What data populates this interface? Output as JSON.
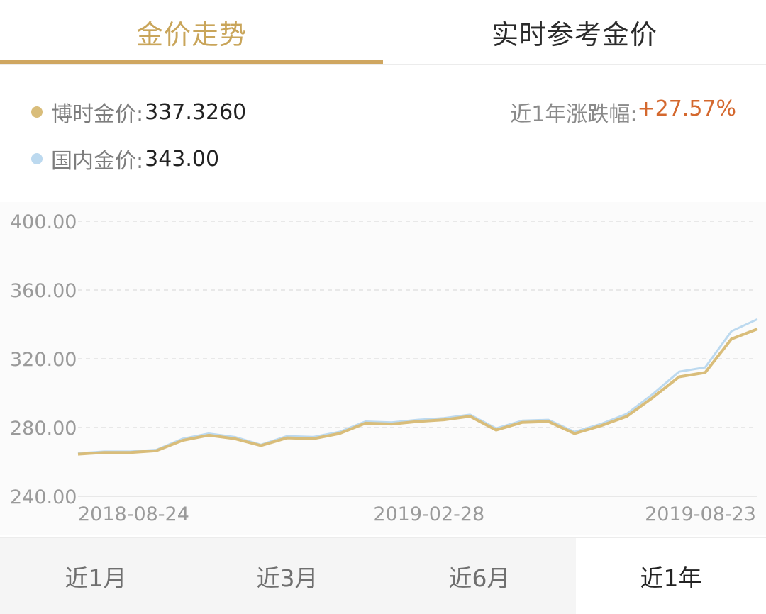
{
  "tabs": {
    "trend": "金价走势",
    "realtime": "实时参考金价"
  },
  "legend": {
    "bosera": {
      "label": "博时金价:",
      "value": "337.3260",
      "color": "#d9bd7a"
    },
    "domestic": {
      "label": "国内金价:",
      "value": "343.00",
      "color": "#bcd9ef"
    }
  },
  "change": {
    "label": "近1年涨跌幅:",
    "value": "+27.57%"
  },
  "periods": [
    "近1月",
    "近3月",
    "近6月",
    "近1年"
  ],
  "active_period": "近1年",
  "chart_data": {
    "type": "line",
    "title": "",
    "ylim": [
      240,
      400
    ],
    "y_ticks": [
      "400.00",
      "360.00",
      "320.00",
      "280.00",
      "240.00"
    ],
    "x_ticks": [
      "2018-08-24",
      "2019-02-28",
      "2019-08-23"
    ],
    "x": [
      "2018-08-24",
      "2018-09-07",
      "2018-09-21",
      "2018-10-05",
      "2018-10-19",
      "2018-11-02",
      "2018-11-16",
      "2018-11-30",
      "2018-12-14",
      "2018-12-28",
      "2019-01-11",
      "2019-01-25",
      "2019-02-08",
      "2019-02-22",
      "2019-03-08",
      "2019-03-22",
      "2019-04-05",
      "2019-04-19",
      "2019-05-03",
      "2019-05-17",
      "2019-05-31",
      "2019-06-14",
      "2019-06-28",
      "2019-07-12",
      "2019-07-26",
      "2019-08-09",
      "2019-08-23"
    ],
    "series": [
      {
        "color": "#d9bd7a",
        "values": [
          264.5,
          265.5,
          265.5,
          266.5,
          272.5,
          275.5,
          273.5,
          269.5,
          274.0,
          273.5,
          276.5,
          282.5,
          282.0,
          283.5,
          284.5,
          286.5,
          278.5,
          283.0,
          283.5,
          276.5,
          281.0,
          286.5,
          297.5,
          309.5,
          312.0,
          331.5,
          337.3
        ]
      },
      {
        "color": "#bcd9ef",
        "values": [
          265.0,
          266.0,
          266.0,
          267.0,
          273.5,
          276.5,
          274.5,
          270.0,
          275.0,
          274.5,
          277.5,
          283.5,
          283.0,
          284.5,
          285.5,
          287.5,
          279.5,
          284.0,
          284.5,
          277.5,
          282.0,
          288.0,
          299.5,
          312.5,
          315.0,
          336.0,
          343.0
        ]
      }
    ]
  }
}
